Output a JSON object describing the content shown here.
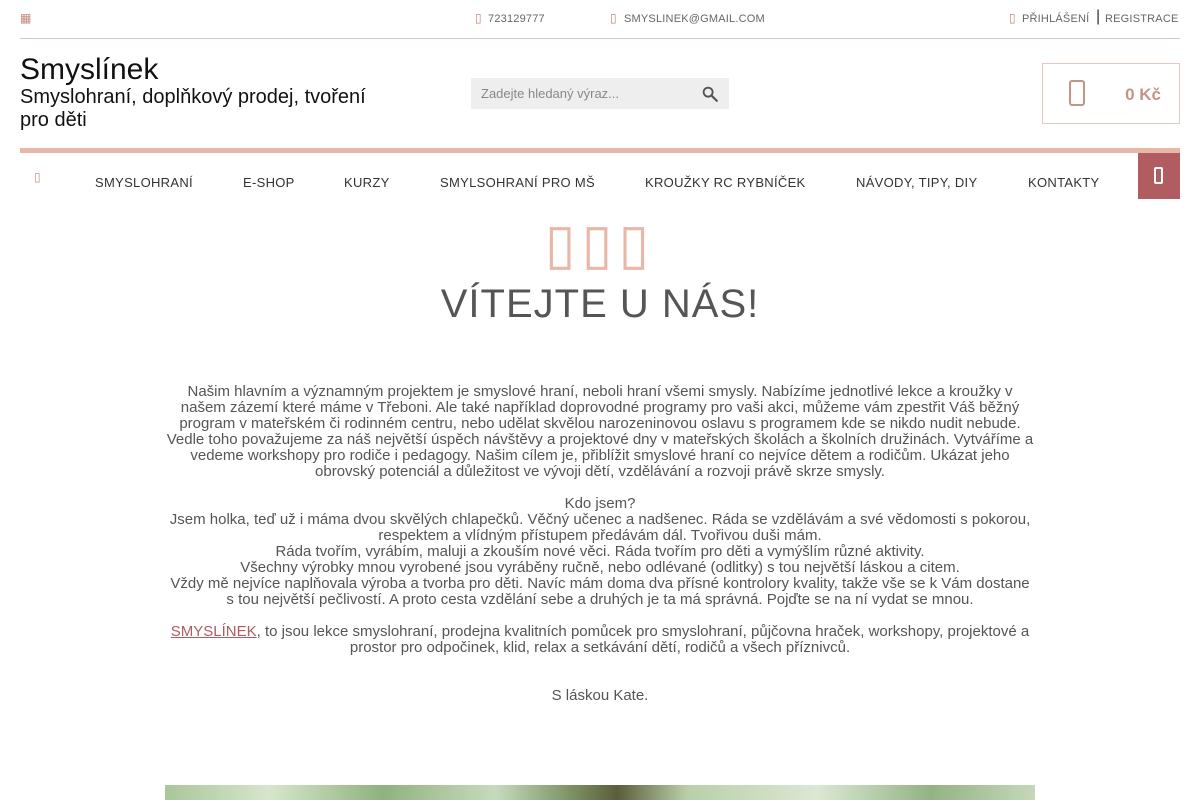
{
  "topbar": {
    "menu_icon": "grid-icon",
    "phone_icon": "phone-icon",
    "phone": "723129777",
    "email_icon": "envelope-icon",
    "email": "SMYSLINEK@GMAIL.COM",
    "login_icon": "user-icon",
    "login": "PŘIHLÁŠENÍ",
    "separator": "|",
    "register": "REGISTRACE"
  },
  "brand": {
    "name": "Smyslínek",
    "tagline": "Smyslohraní, doplňkový prodej, tvoření pro děti"
  },
  "search": {
    "placeholder": "Zadejte hledaný výraz...",
    "value": "",
    "icon": "search-icon"
  },
  "cart": {
    "icon": "cart-icon",
    "total": "0 Kč"
  },
  "nav": {
    "home_icon": "home-icon",
    "items": [
      {
        "label": "SMYSLOHRANÍ"
      },
      {
        "label": "E-SHOP"
      },
      {
        "label": "KURZY"
      },
      {
        "label": "SMYLSOHRANÍ PRO MŠ"
      },
      {
        "label": "KROUŽKY RC RYBNÍČEK"
      },
      {
        "label": "NÁVODY, TIPY, DIY"
      },
      {
        "label": "KONTAKTY"
      }
    ],
    "end_button_icon": "phone-icon"
  },
  "hero": {
    "deco_icon": "flowers-icon",
    "title": "VÍTEJTE U NÁS!"
  },
  "intro": {
    "p1": "Našim hlavním a významným projektem je smyslové hraní, neboli hraní všemi smysly. Nabízíme jednotlivé lekce a kroužky v našem zázemí které máme v Třeboni. Ale také například doprovodné programy pro vaši akci, můžeme vám zpestřit Váš běžný program v mateřském či rodinném centru, nebo udělat skvělou narozeninovou oslavu s programem kde se nikdo nudit nebude. Vedle toho považujeme za náš největší úspěch návštěvy a projektové dny v mateřských školách a školních družinách. Vytváříme a vedeme workshopy pro rodiče i pedagogy. Našim cílem je, přiblížit smyslové hraní co nejvíce dětem a rodičům. Ukázat jeho obrovský potenciál a důležitost ve vývoji dětí, vzdělávání a rozvoji právě skrze smysly.",
    "q": "Kdo jsem?",
    "p2": "Jsem holka, teď už i máma dvou skvělých chlapečků. Věčný učenec a nadšenec. Ráda se vzdělávám a své vědomosti s pokorou, respektem a vlídným přístupem předávám dál.  Tvořivou duši mám.",
    "p3": "Ráda tvořím, vyrábím, maluji a zkouším nové věci. Ráda tvořím pro děti a vymýšlím různé aktivity.",
    "p4": "Všechny výrobky mnou vyrobené jsou vyráběny ručně, nebo odlévané (odlitky) s tou největší láskou a citem.",
    "p5": "Vždy mě nejvíce naplňovala výroba a tvorba pro děti. Navíc mám doma dva přísné kontrolory kvality, takže vše se k Vám dostane s tou největší pečlivostí. A proto cesta vzdělání sebe a druhých je ta má správná. Pojďte se na ní vydat se mnou.",
    "link": "SMYSLÍNEK",
    "p6": ", to jsou lekce smyslohraní, prodejna kvalitních pomůcek pro smyslohraní, půjčovna hraček, workshopy, projektové a prostor pro odpočinek, klid, relax a setkávání dětí, rodičů a všech příznivců.",
    "signature": "S láskou Kate."
  }
}
